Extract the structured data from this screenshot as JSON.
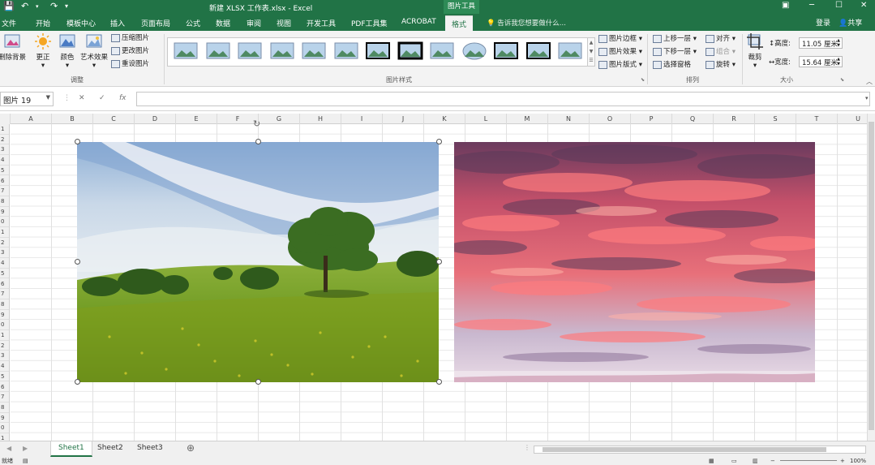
{
  "window": {
    "title": "新建 XLSX 工作表.xlsx - Excel",
    "context_tab_group": "图片工具"
  },
  "tabs": [
    "文件",
    "开始",
    "模板中心",
    "插入",
    "页面布局",
    "公式",
    "数据",
    "审阅",
    "视图",
    "开发工具",
    "PDF工具集",
    "ACROBAT",
    "格式"
  ],
  "active_tab": "格式",
  "tell_me": "告诉我您想要做什么...",
  "account": {
    "login": "登录",
    "share": "共享"
  },
  "ribbon": {
    "adjust": {
      "remove_bg": "删除背景",
      "correct": "更正",
      "color": "颜色",
      "art": "艺术效果",
      "compress": "压缩图片",
      "change": "更改图片",
      "reset": "重设图片",
      "group_label": "调整"
    },
    "styles": {
      "group_label": "图片样式",
      "border": "图片边框",
      "effects": "图片效果",
      "layout": "图片版式"
    },
    "arrange": {
      "forward": "上移一层",
      "backward": "下移一层",
      "pane": "选择窗格",
      "align": "对齐",
      "group": "组合",
      "rotate": "旋转",
      "group_label": "排列"
    },
    "size": {
      "crop": "裁剪",
      "height_label": "高度:",
      "height": "11.05 厘米",
      "width_label": "宽度:",
      "width": "15.64 厘米",
      "group_label": "大小"
    }
  },
  "formula_bar": {
    "name_box": "图片 19",
    "cancel": "✕",
    "enter": "✓",
    "fx": "fx",
    "formula": ""
  },
  "columns": [
    "A",
    "B",
    "C",
    "D",
    "E",
    "F",
    "G",
    "H",
    "I",
    "J",
    "K",
    "L",
    "M",
    "N",
    "O",
    "P",
    "Q",
    "R",
    "S",
    "T",
    "U"
  ],
  "rows": [
    "1",
    "2",
    "3",
    "4",
    "5",
    "6",
    "7",
    "8",
    "9",
    "0",
    "1",
    "2",
    "3",
    "4",
    "5",
    "6",
    "7",
    "8",
    "9",
    "0",
    "1",
    "2",
    "3",
    "4",
    "5",
    "6",
    "7",
    "8",
    "9",
    "0",
    "1"
  ],
  "sheets": [
    "Sheet1",
    "Sheet2",
    "Sheet3"
  ],
  "active_sheet": "Sheet1",
  "status": {
    "ready": "就绪",
    "zoom": "100%"
  },
  "colors": {
    "excel_green": "#217346",
    "ribbon_bg": "#f3f3f3"
  }
}
